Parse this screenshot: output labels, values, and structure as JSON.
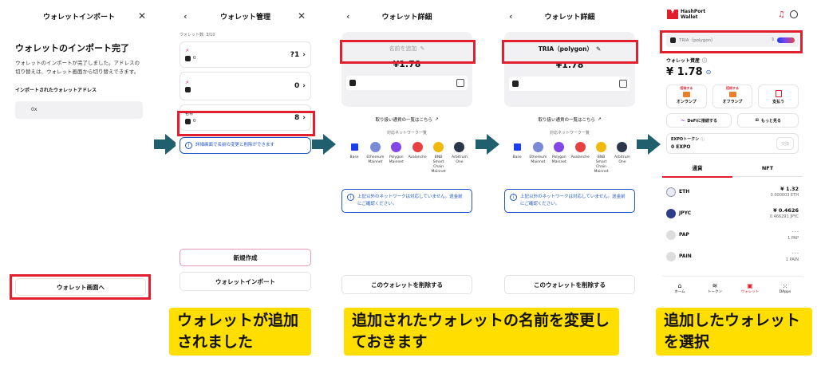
{
  "p1": {
    "header_title": "ウォレットインポート",
    "close": "✕",
    "heading": "ウォレットのインポート完了",
    "body": "ウォレットのインポートが完了しました。アドレスの切り替えは、ウォレット画面から切り替えできます。",
    "address_label": "インポートされたウォレットアドレス",
    "address_value": "0x",
    "go_button": "ウォレット画面へ"
  },
  "p2": {
    "back": "‹",
    "header_title": "ウォレット管理",
    "close": "✕",
    "count": "ウォレット数: 3/10",
    "wallets": [
      {
        "name": "メ",
        "balance": "0",
        "value": "?1"
      },
      {
        "name": "メ",
        "balance": "0",
        "value": "0"
      },
      {
        "name": "名称",
        "balance": "0",
        "value": "8"
      }
    ],
    "notice": "詳細画面で名前の変更と削除ができます",
    "create_button": "新規作成",
    "import_button": "ウォレットインポート"
  },
  "p3": {
    "back": "‹",
    "header_title": "ウォレット詳細",
    "name_placeholder": "名前を追加",
    "amount": "¥1.78",
    "tx_link": "取り扱い通貨の一覧はこちら",
    "supported_label": "対応ネットワーク一覧",
    "notice": "上記以外のネットワークは対応していません。送金前にご確認ください。",
    "delete_button": "このウォレットを削除する"
  },
  "p4": {
    "back": "‹",
    "header_title": "ウォレット詳細",
    "name_value": "TRIA（polygon）",
    "amount": "¥1.78",
    "tx_link": "取り扱い通貨の一覧はこちら",
    "supported_label": "対応ネットワーク一覧",
    "notice": "上記以外のネットワークは対応していません。送金前にご確認ください。",
    "delete_button": "このウォレットを削除する"
  },
  "networks": [
    {
      "name": "Base",
      "color": "#1a3df0"
    },
    {
      "name": "Ethereum Mainnet",
      "color": "#7b8ad6"
    },
    {
      "name": "Polygon Mainnet",
      "color": "#8247e5"
    },
    {
      "name": "Avalanche",
      "color": "#e84142"
    },
    {
      "name": "BNB Smart Chain Mainnet",
      "color": "#f0b90b"
    },
    {
      "name": "Arbitrum One",
      "color": "#2d374b"
    }
  ],
  "p5": {
    "logo_line1": "HashPort",
    "logo_line2": "Wallet",
    "wallet_select": "TRIA（polygon）",
    "assets_label": "ウォレット資産",
    "assets_value": "¥ 1.78",
    "actions": [
      {
        "label": "オンランプ",
        "badge": "招待する"
      },
      {
        "label": "オフランプ",
        "badge": "招待する"
      },
      {
        "label": "支払う",
        "badge": ""
      }
    ],
    "defi": "DeFiに接続する",
    "more": "もっと見る",
    "expo_label": "EXPOトークン",
    "expo_value": "0 EXPO",
    "claim": "交換",
    "tabs": [
      "通貨",
      "NFT"
    ],
    "tokens": [
      {
        "symbol": "ETH",
        "jpy": "¥ 1.32",
        "amount": "0.000003 ETH"
      },
      {
        "symbol": "JPYC",
        "jpy": "¥ 0.4626",
        "amount": "0.466291 JPYC"
      },
      {
        "symbol": "PAP",
        "jpy": "- - -",
        "amount": "1 PAP"
      },
      {
        "symbol": "PAIN",
        "jpy": "- - -",
        "amount": "1 PAIN"
      }
    ],
    "nav": [
      "ホーム",
      "トークン",
      "ウォレット",
      "DApps"
    ]
  },
  "captions": [
    "ウォレットが追加されました",
    "追加されたウォレットの名前を変更しておきます",
    "追加したウォレットを選択"
  ],
  "accent": "#e21f2e",
  "arrow_color": "#1f5f6e",
  "caption_color": "#ffde00"
}
